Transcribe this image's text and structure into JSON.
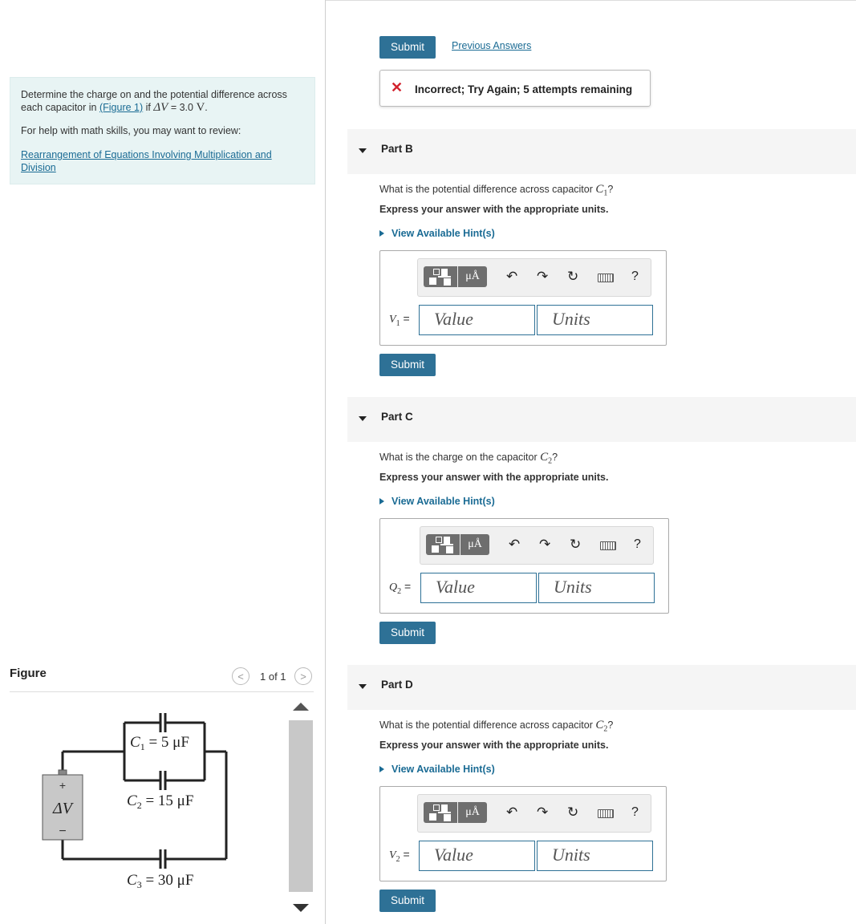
{
  "problem": {
    "line1": "Determine the charge on and the potential difference across",
    "line2_pre": "each capacitor in ",
    "figure_link": "(Figure 1)",
    "line2_mid": " if ",
    "delta_v": "ΔV",
    "line2_eq": " = 3.0 ",
    "unit_v": "V",
    "line2_end": ".",
    "help_text": "For help with math skills, you may want to review:",
    "review_link_line1": "Rearrangement of Equations Involving Multiplication and",
    "review_link_line2": "Division"
  },
  "top": {
    "submit_label": "Submit",
    "previous_answers": "Previous Answers",
    "feedback_icon": "✕",
    "feedback_text": "Incorrect; Try Again; 5 attempts remaining"
  },
  "toolbar": {
    "unit_symbol": "μÅ",
    "undo": "↶",
    "redo": "↷",
    "reset": "↻",
    "help": "?"
  },
  "parts": [
    {
      "title": "Part B",
      "question_pre": "What is the potential difference across capacitor ",
      "var": "C",
      "sub": "1",
      "question_post": "?",
      "express": "Express your answer with the appropriate units.",
      "hint": "View Available Hint(s)",
      "answer_var": "V",
      "answer_sub": "1",
      "value_placeholder": "Value",
      "units_placeholder": "Units",
      "submit_label": "Submit"
    },
    {
      "title": "Part C",
      "question_pre": "What is the charge on the capacitor ",
      "var": "C",
      "sub": "2",
      "question_post": "?",
      "express": "Express your answer with the appropriate units.",
      "hint": "View Available Hint(s)",
      "answer_var": "Q",
      "answer_sub": "2",
      "value_placeholder": "Value",
      "units_placeholder": "Units",
      "submit_label": "Submit"
    },
    {
      "title": "Part D",
      "question_pre": "What is the potential difference across capacitor ",
      "var": "C",
      "sub": "2",
      "question_post": "?",
      "express": "Express your answer with the appropriate units.",
      "hint": "View Available Hint(s)",
      "answer_var": "V",
      "answer_sub": "2",
      "value_placeholder": "Value",
      "units_placeholder": "Units",
      "submit_label": "Submit"
    }
  ],
  "figure": {
    "title": "Figure",
    "counter": "1 of 1",
    "prev": "<",
    "next": ">",
    "battery_plus": "+",
    "battery_label": "ΔV",
    "battery_minus": "−",
    "c1_label": "C",
    "c1_sub": "1",
    "c1_value": " = 5 μF",
    "c2_label": "C",
    "c2_sub": "2",
    "c2_value": " = 15 μF",
    "c3_label": "C",
    "c3_sub": "3",
    "c3_value": " = 30 μF"
  }
}
